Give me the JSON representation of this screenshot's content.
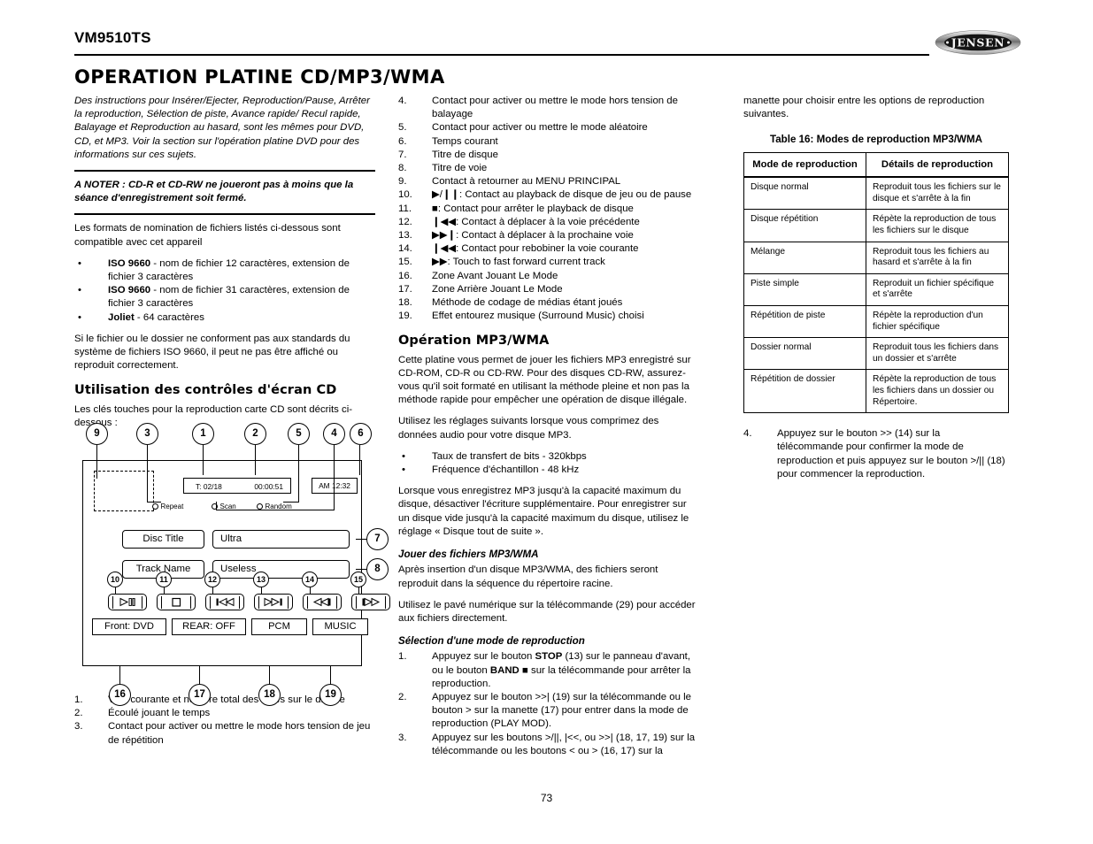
{
  "header": {
    "model": "VM9510TS",
    "brand": "JENSEN"
  },
  "section_title": "OPERATION PLATINE CD/MP3/WMA",
  "col1": {
    "intro": "Des instructions pour Insérer/Ejecter, Reproduction/Pause, Arrêter la reproduction, Sélection de piste, Avance rapide/ Recul rapide, Balayage et Reproduction au hasard, sont les mêmes pour DVD, CD, et MP3. Voir la section sur l'opération platine DVD pour des informations sur ces sujets.",
    "note": "A NOTER : CD-R et CD-RW ne joueront pas à moins que la séance d'enregistrement soit fermé.",
    "formats_intro": "Les formats de nomination de fichiers listés ci-dessous sont compatible avec cet appareil",
    "formats": [
      {
        "bold": "ISO 9660",
        "rest": " - nom de fichier 12 caractères, extension de fichier 3 caractères"
      },
      {
        "bold": "ISO 9660",
        "rest": " - nom de fichier 31 caractères, extension de fichier 3 caractères"
      },
      {
        "bold": "Joliet",
        "rest": " - 64 caractères"
      }
    ],
    "iso_note": "Si le fichier ou le dossier ne conforment pas aux standards du système de fichiers ISO 9660, il peut ne pas être affiché ou reproduit correctement.",
    "screen_heading": "Utilisation des contrôles d'écran CD",
    "screen_intro": "Les clés touches pour la reproduction carte CD sont décrits ci-dessous :",
    "list_1_3": [
      {
        "n": "1.",
        "t": "Voie courante et nombre total des voies sur le disque"
      },
      {
        "n": "2.",
        "t": "Écoulé jouant le temps"
      },
      {
        "n": "3.",
        "t": "Contact pour activer ou mettre le mode hors tension de jeu de répétition"
      }
    ]
  },
  "diagram": {
    "callouts": [
      "1",
      "2",
      "3",
      "4",
      "5",
      "6",
      "7",
      "8",
      "9",
      "10",
      "11",
      "12",
      "13",
      "14",
      "15",
      "16",
      "17",
      "18",
      "19"
    ],
    "lcd_track": "T: 02/18",
    "lcd_time": "00:00:51",
    "lcd_clock": "AM 12:32",
    "radio_repeat": "Repeat",
    "radio_scan": "Scan",
    "radio_random": "Random",
    "disc_title_label": "Disc Title",
    "disc_title_value": "Ultra",
    "track_name_label": "Track Name",
    "track_name_value": "Useless",
    "status_front": "Front: DVD",
    "status_rear": "REAR: OFF",
    "status_codec": "PCM",
    "status_surround": "MUSIC",
    "buttons": [
      "play-pause-icon",
      "stop-icon",
      "prev-track-icon",
      "next-track-icon",
      "rewind-icon",
      "fast-forward-icon"
    ]
  },
  "col2": {
    "list_4_19": [
      {
        "n": "4.",
        "glyph": "",
        "t": "Contact pour activer ou mettre le mode hors tension de balayage"
      },
      {
        "n": "5.",
        "glyph": "",
        "t": "Contact pour activer ou mettre le mode aléatoire"
      },
      {
        "n": "6.",
        "glyph": "",
        "t": "Temps courant"
      },
      {
        "n": "7.",
        "glyph": "",
        "t": "Titre de disque"
      },
      {
        "n": "8.",
        "glyph": "",
        "t": "Titre de voie"
      },
      {
        "n": "9.",
        "glyph": "",
        "t": "Contact à retourner au MENU PRINCIPAL"
      },
      {
        "n": "10.",
        "glyph": "▶/❙❙",
        "t": ": Contact au playback de disque de jeu ou de pause"
      },
      {
        "n": "11.",
        "glyph": "■",
        "t": ": Contact pour arrêter le playback de disque"
      },
      {
        "n": "12.",
        "glyph": "❙◀◀",
        "t": ": Contact à déplacer à la voie précédente"
      },
      {
        "n": "13.",
        "glyph": "▶▶❙",
        "t": ": Contact à déplacer à la prochaine voie"
      },
      {
        "n": "14.",
        "glyph": "❙◀◀",
        "t": ": Contact pour rebobiner la voie courante"
      },
      {
        "n": "15.",
        "glyph": "▶▶",
        "t": ": Touch to fast forward current track"
      },
      {
        "n": "16.",
        "glyph": "",
        "t": "Zone Avant Jouant Le Mode"
      },
      {
        "n": "17.",
        "glyph": "",
        "t": "Zone Arrière Jouant Le Mode"
      },
      {
        "n": "18.",
        "glyph": "",
        "t": "Méthode de codage de médias étant joués"
      },
      {
        "n": "19.",
        "glyph": "",
        "t": "Effet entourez musique (Surround Music) choisi"
      }
    ],
    "mp3_heading": "Opération MP3/WMA",
    "mp3_p1": "Cette platine vous permet de jouer les fichiers MP3 enregistré sur CD-ROM, CD-R ou CD-RW. Pour des disques CD-RW, assurez-vous qu'il soit formaté en utilisant la méthode pleine et non pas la méthode rapide pour empêcher une opération de disque illégale.",
    "mp3_p2": "Utilisez les réglages suivants lorsque vous comprimez des données audio pour votre disque MP3.",
    "mp3_bullets": [
      "Taux de transfert de bits - 320kbps",
      "Fréquence d'échantillon - 48 kHz"
    ],
    "mp3_p3": "Lorsque vous enregistrez MP3 jusqu'à la capacité maximum du disque, désactiver l'écriture supplémentaire. Pour enregistrer sur un disque vide jusqu'à la capacité maximum du disque, utilisez le réglage « Disque tout de suite ».",
    "play_heading": "Jouer des fichiers MP3/WMA",
    "play_p1": "Après insertion d'un disque MP3/WMA, des fichiers seront reproduit dans la séquence du répertoire racine.",
    "play_p2": "Utilisez le pavé numérique sur la télécommande (29) pour accéder aux fichiers directement.",
    "sel_heading": "Sélection d'une mode de reproduction",
    "sel_1_pre": "Appuyez sur le bouton ",
    "sel_1_b1": "STOP",
    "sel_1_mid": " (13) sur le panneau d'avant, ou le bouton ",
    "sel_1_b2": "BAND",
    "sel_1_glyph": " ■ ",
    "sel_1_post": "sur la télécommande pour arrêter la reproduction.",
    "sel_2": "Appuyez sur le bouton >>| (19) sur la télécommande ou le bouton > sur la manette (17) pour entrer dans la mode de reproduction (PLAY MOD).",
    "sel_3": "Appuyez sur les boutons >/||, |<<, ou >>| (18, 17, 19) sur la télécommande ou les boutons < ou > (16, 17) sur la"
  },
  "col3": {
    "cont": "manette pour choisir entre les options de reproduction suivantes.",
    "table_caption": "Table 16: Modes de reproduction MP3/WMA",
    "table_headers": [
      "Mode de reproduction",
      "Détails de reproduction"
    ],
    "table_rows": [
      [
        "Disque normal",
        "Reproduit tous les fichiers sur le disque et s'arrête à la fin"
      ],
      [
        "Disque répétition",
        "Répète la reproduction de tous les fichiers sur le disque"
      ],
      [
        "Mélange",
        "Reproduit tous les fichiers au hasard et s'arrête à la fin"
      ],
      [
        "Piste simple",
        "Reproduit un fichier spécifique et s'arrête"
      ],
      [
        "Répétition de piste",
        "Répète la reproduction d'un fichier spécifique"
      ],
      [
        "Dossier normal",
        "Reproduit tous les fichiers dans un dossier et s'arrête"
      ],
      [
        "Répétition de dossier",
        "Répète la reproduction de tous les fichiers dans un dossier ou Répertoire."
      ]
    ],
    "step4_n": "4.",
    "step4": "Appuyez sur le bouton >> (14) sur la télécommande pour confirmer la mode de reproduction et puis appuyez sur le bouton >/|| (18) pour commencer la reproduction."
  },
  "page_number": "73"
}
